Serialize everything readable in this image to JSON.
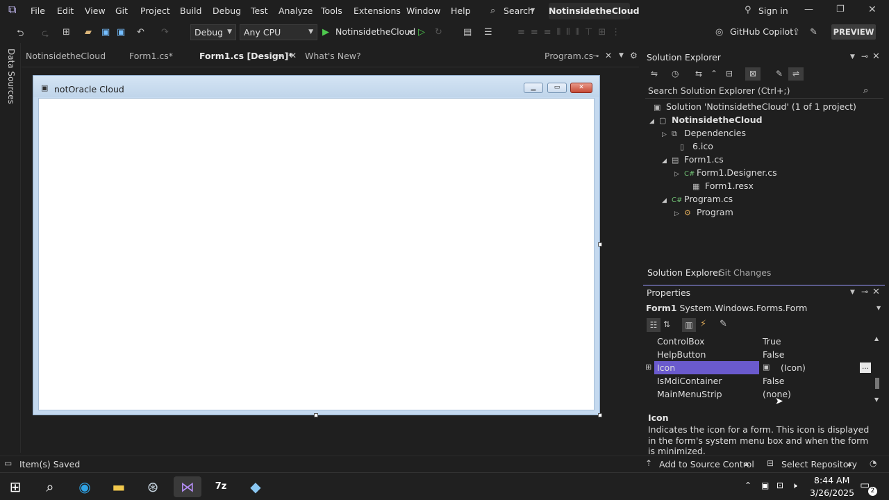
{
  "menu": {
    "items": [
      "File",
      "Edit",
      "View",
      "Git",
      "Project",
      "Build",
      "Debug",
      "Test",
      "Analyze",
      "Tools",
      "Extensions",
      "Window",
      "Help"
    ],
    "search_label": "Search",
    "solution_title": "NotinsidetheCloud",
    "sign_in": "Sign in"
  },
  "toolbar": {
    "config": "Debug",
    "platform": "Any CPU",
    "run_target": "NotinsidetheCloud",
    "copilot": "GitHub Copilot",
    "preview": "PREVIEW"
  },
  "left_strip": {
    "label": "Data Sources"
  },
  "doc_tabs": {
    "tabs": [
      "NotinsidetheCloud",
      "Form1.cs*",
      "Form1.cs [Design]*",
      "What's New?"
    ],
    "right_tab": "Program.cs"
  },
  "designer": {
    "form_title": "notOracle Cloud"
  },
  "solution_explorer": {
    "title": "Solution Explorer",
    "search_placeholder": "Search Solution Explorer (Ctrl+;)",
    "tree": [
      {
        "label": "Solution 'NotinsidetheCloud' (1 of 1 project)",
        "icon": "solution-icon"
      },
      {
        "label": "NotinsidetheCloud",
        "icon": "csharp-project-icon"
      },
      {
        "label": "Dependencies",
        "icon": "dependencies-icon"
      },
      {
        "label": "6.ico",
        "icon": "file-icon"
      },
      {
        "label": "Form1.cs",
        "icon": "form-icon"
      },
      {
        "label": "Form1.Designer.cs",
        "icon": "csharp-file-icon"
      },
      {
        "label": "Form1.resx",
        "icon": "resx-icon"
      },
      {
        "label": "Program.cs",
        "icon": "csharp-file-icon"
      },
      {
        "label": "Program",
        "icon": "class-icon"
      }
    ],
    "tabs": [
      "Solution Explorer",
      "Git Changes"
    ]
  },
  "properties": {
    "title": "Properties",
    "object_name": "Form1",
    "object_type": "System.Windows.Forms.Form",
    "rows": [
      {
        "name": "ControlBox",
        "value": "True"
      },
      {
        "name": "HelpButton",
        "value": "False"
      },
      {
        "name": "Icon",
        "value": "(Icon)"
      },
      {
        "name": "IsMdiContainer",
        "value": "False"
      },
      {
        "name": "MainMenuStrip",
        "value": "(none)"
      }
    ],
    "desc_title": "Icon",
    "desc_text": "Indicates the icon for a form. This icon is displayed in the form's system menu box and when the form is minimized."
  },
  "statusbar": {
    "saved": "Item(s) Saved",
    "source_control": "Add to Source Control",
    "repository": "Select Repository"
  },
  "taskbar": {
    "time": "8:44 AM",
    "date": "3/26/2025",
    "notifications": "2"
  }
}
